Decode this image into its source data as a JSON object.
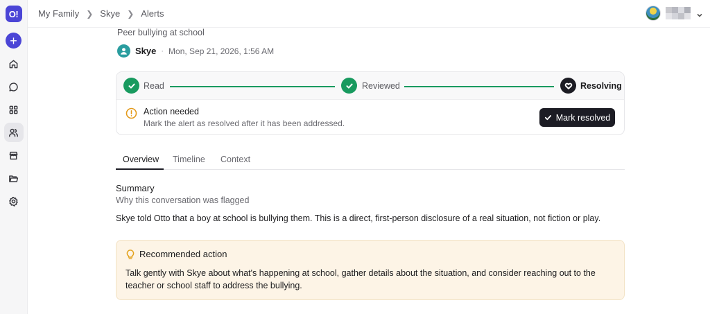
{
  "app": {
    "logo_text": "O!"
  },
  "breadcrumb": {
    "items": [
      "My Family",
      "Skye",
      "Alerts"
    ]
  },
  "alert": {
    "title": "Peer bullying at school",
    "person_name": "Skye",
    "separator": "·",
    "date": "Mon, Sep 21, 2026, 1:56 AM"
  },
  "progress": {
    "steps": [
      {
        "label": "Read",
        "status": "done"
      },
      {
        "label": "Reviewed",
        "status": "done"
      },
      {
        "label": "Resolving",
        "status": "current"
      }
    ],
    "accent_color": "#189a5f"
  },
  "action": {
    "title": "Action needed",
    "subtitle": "Mark the alert as resolved after it has been addressed.",
    "button_label": "Mark resolved"
  },
  "tabs": [
    {
      "label": "Overview",
      "active": true
    },
    {
      "label": "Timeline",
      "active": false
    },
    {
      "label": "Context",
      "active": false
    }
  ],
  "summary": {
    "title": "Summary",
    "subtitle": "Why this conversation was flagged",
    "body": "Skye told Otto that a boy at school is bullying them. This is a direct, first-person disclosure of a real situation, not fiction or play."
  },
  "recommended": {
    "title": "Recommended action",
    "body": "Talk gently with Skye about what's happening at school, gather details about the situation, and consider reaching out to the teacher or school staff to address the bullying."
  },
  "sidebar": {
    "items": [
      "home-icon",
      "chat-icon",
      "apps-grid-icon",
      "family-icon",
      "store-icon",
      "folder-icon",
      "settings-icon"
    ],
    "active": "family-icon"
  }
}
